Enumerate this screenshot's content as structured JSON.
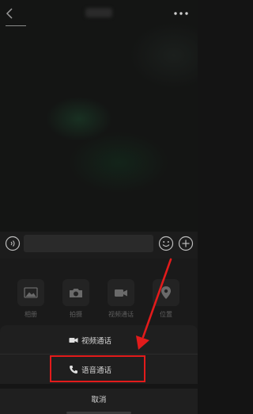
{
  "header": {
    "back_icon": "chevron-left-icon",
    "more_icon": "more-dots-icon"
  },
  "input_bar": {
    "voice_icon": "voice-input-icon",
    "emoji_icon": "emoji-icon",
    "plus_icon": "plus-icon",
    "text_value": ""
  },
  "panel": {
    "items": [
      {
        "label": "相册",
        "icon": "image-icon"
      },
      {
        "label": "拍摄",
        "icon": "camera-icon"
      },
      {
        "label": "视频通话",
        "icon": "video-camera-icon"
      },
      {
        "label": "位置",
        "icon": "location-pin-icon"
      }
    ]
  },
  "sheet": {
    "video_call": "视频通话",
    "voice_call": "语音通话",
    "cancel": "取消"
  },
  "colors": {
    "highlight": "#e21b1b",
    "background": "#141414",
    "sheet": "#1f1f1f"
  }
}
